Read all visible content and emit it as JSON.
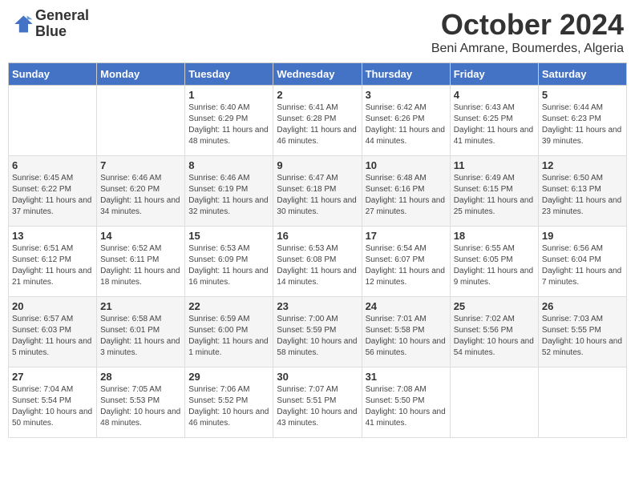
{
  "header": {
    "logo_line1": "General",
    "logo_line2": "Blue",
    "month": "October 2024",
    "location": "Beni Amrane, Boumerdes, Algeria"
  },
  "days_of_week": [
    "Sunday",
    "Monday",
    "Tuesday",
    "Wednesday",
    "Thursday",
    "Friday",
    "Saturday"
  ],
  "weeks": [
    [
      {
        "day": "",
        "info": ""
      },
      {
        "day": "",
        "info": ""
      },
      {
        "day": "1",
        "info": "Sunrise: 6:40 AM\nSunset: 6:29 PM\nDaylight: 11 hours and 48 minutes."
      },
      {
        "day": "2",
        "info": "Sunrise: 6:41 AM\nSunset: 6:28 PM\nDaylight: 11 hours and 46 minutes."
      },
      {
        "day": "3",
        "info": "Sunrise: 6:42 AM\nSunset: 6:26 PM\nDaylight: 11 hours and 44 minutes."
      },
      {
        "day": "4",
        "info": "Sunrise: 6:43 AM\nSunset: 6:25 PM\nDaylight: 11 hours and 41 minutes."
      },
      {
        "day": "5",
        "info": "Sunrise: 6:44 AM\nSunset: 6:23 PM\nDaylight: 11 hours and 39 minutes."
      }
    ],
    [
      {
        "day": "6",
        "info": "Sunrise: 6:45 AM\nSunset: 6:22 PM\nDaylight: 11 hours and 37 minutes."
      },
      {
        "day": "7",
        "info": "Sunrise: 6:46 AM\nSunset: 6:20 PM\nDaylight: 11 hours and 34 minutes."
      },
      {
        "day": "8",
        "info": "Sunrise: 6:46 AM\nSunset: 6:19 PM\nDaylight: 11 hours and 32 minutes."
      },
      {
        "day": "9",
        "info": "Sunrise: 6:47 AM\nSunset: 6:18 PM\nDaylight: 11 hours and 30 minutes."
      },
      {
        "day": "10",
        "info": "Sunrise: 6:48 AM\nSunset: 6:16 PM\nDaylight: 11 hours and 27 minutes."
      },
      {
        "day": "11",
        "info": "Sunrise: 6:49 AM\nSunset: 6:15 PM\nDaylight: 11 hours and 25 minutes."
      },
      {
        "day": "12",
        "info": "Sunrise: 6:50 AM\nSunset: 6:13 PM\nDaylight: 11 hours and 23 minutes."
      }
    ],
    [
      {
        "day": "13",
        "info": "Sunrise: 6:51 AM\nSunset: 6:12 PM\nDaylight: 11 hours and 21 minutes."
      },
      {
        "day": "14",
        "info": "Sunrise: 6:52 AM\nSunset: 6:11 PM\nDaylight: 11 hours and 18 minutes."
      },
      {
        "day": "15",
        "info": "Sunrise: 6:53 AM\nSunset: 6:09 PM\nDaylight: 11 hours and 16 minutes."
      },
      {
        "day": "16",
        "info": "Sunrise: 6:53 AM\nSunset: 6:08 PM\nDaylight: 11 hours and 14 minutes."
      },
      {
        "day": "17",
        "info": "Sunrise: 6:54 AM\nSunset: 6:07 PM\nDaylight: 11 hours and 12 minutes."
      },
      {
        "day": "18",
        "info": "Sunrise: 6:55 AM\nSunset: 6:05 PM\nDaylight: 11 hours and 9 minutes."
      },
      {
        "day": "19",
        "info": "Sunrise: 6:56 AM\nSunset: 6:04 PM\nDaylight: 11 hours and 7 minutes."
      }
    ],
    [
      {
        "day": "20",
        "info": "Sunrise: 6:57 AM\nSunset: 6:03 PM\nDaylight: 11 hours and 5 minutes."
      },
      {
        "day": "21",
        "info": "Sunrise: 6:58 AM\nSunset: 6:01 PM\nDaylight: 11 hours and 3 minutes."
      },
      {
        "day": "22",
        "info": "Sunrise: 6:59 AM\nSunset: 6:00 PM\nDaylight: 11 hours and 1 minute."
      },
      {
        "day": "23",
        "info": "Sunrise: 7:00 AM\nSunset: 5:59 PM\nDaylight: 10 hours and 58 minutes."
      },
      {
        "day": "24",
        "info": "Sunrise: 7:01 AM\nSunset: 5:58 PM\nDaylight: 10 hours and 56 minutes."
      },
      {
        "day": "25",
        "info": "Sunrise: 7:02 AM\nSunset: 5:56 PM\nDaylight: 10 hours and 54 minutes."
      },
      {
        "day": "26",
        "info": "Sunrise: 7:03 AM\nSunset: 5:55 PM\nDaylight: 10 hours and 52 minutes."
      }
    ],
    [
      {
        "day": "27",
        "info": "Sunrise: 7:04 AM\nSunset: 5:54 PM\nDaylight: 10 hours and 50 minutes."
      },
      {
        "day": "28",
        "info": "Sunrise: 7:05 AM\nSunset: 5:53 PM\nDaylight: 10 hours and 48 minutes."
      },
      {
        "day": "29",
        "info": "Sunrise: 7:06 AM\nSunset: 5:52 PM\nDaylight: 10 hours and 46 minutes."
      },
      {
        "day": "30",
        "info": "Sunrise: 7:07 AM\nSunset: 5:51 PM\nDaylight: 10 hours and 43 minutes."
      },
      {
        "day": "31",
        "info": "Sunrise: 7:08 AM\nSunset: 5:50 PM\nDaylight: 10 hours and 41 minutes."
      },
      {
        "day": "",
        "info": ""
      },
      {
        "day": "",
        "info": ""
      }
    ]
  ]
}
